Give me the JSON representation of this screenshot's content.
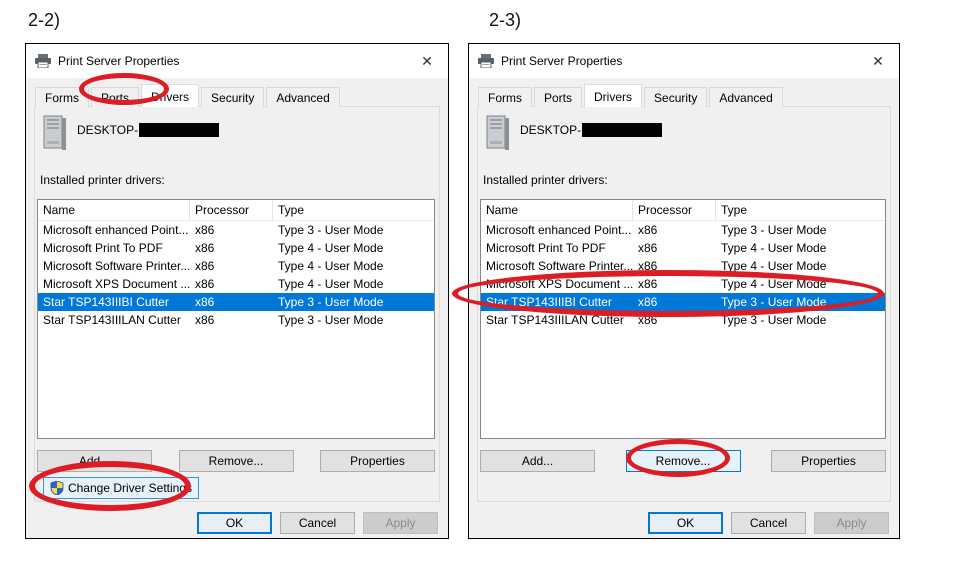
{
  "page": {
    "figure_labels": [
      "2-2)",
      "2-3)"
    ],
    "colors": {
      "annotation_red": "#dd1c24",
      "accent_blue": "#0078d7",
      "dialog_bg": "#f0f0f0",
      "selected_row_bg": "#0078d7"
    }
  },
  "windows": [
    {
      "title": "Print Server Properties",
      "close_glyph": "✕",
      "titlebar_icon": "printer-icon",
      "tabs": [
        "Forms",
        "Ports",
        "Drivers",
        "Security",
        "Advanced"
      ],
      "active_tab": "Drivers",
      "server_icon": "computer-icon",
      "server_name": "DESKTOP-",
      "server_name_redacted": true,
      "list_label": "Installed printer drivers:",
      "columns": [
        "Name",
        "Processor",
        "Type"
      ],
      "rows": [
        {
          "name": "Microsoft enhanced Point...",
          "processor": "x86",
          "type": "Type 3 - User Mode",
          "selected": false
        },
        {
          "name": "Microsoft Print To PDF",
          "processor": "x86",
          "type": "Type 4 - User Mode",
          "selected": false
        },
        {
          "name": "Microsoft Software Printer...",
          "processor": "x86",
          "type": "Type 4 - User Mode",
          "selected": false
        },
        {
          "name": "Microsoft XPS Document ...",
          "processor": "x86",
          "type": "Type 4 - User Mode",
          "selected": false
        },
        {
          "name": "Star TSP143IIIBI Cutter",
          "processor": "x86",
          "type": "Type 3 - User Mode",
          "selected": true
        },
        {
          "name": "Star TSP143IIILAN Cutter",
          "processor": "x86",
          "type": "Type 3 - User Mode",
          "selected": false
        }
      ],
      "buttons": {
        "add": "Add...",
        "remove": "Remove...",
        "properties": "Properties"
      },
      "change_driver_settings_label": "Change Driver Settings",
      "change_driver_settings_icon": "shield-icon",
      "footer_buttons": {
        "ok": "OK",
        "cancel": "Cancel",
        "apply": "Apply"
      },
      "annotated": [
        "Drivers tab circled",
        "Change Driver Settings circled"
      ]
    },
    {
      "title": "Print Server Properties",
      "close_glyph": "✕",
      "titlebar_icon": "printer-icon",
      "tabs": [
        "Forms",
        "Ports",
        "Drivers",
        "Security",
        "Advanced"
      ],
      "active_tab": "Drivers",
      "server_icon": "computer-icon",
      "server_name": "DESKTOP-",
      "server_name_redacted": true,
      "list_label": "Installed printer drivers:",
      "columns": [
        "Name",
        "Processor",
        "Type"
      ],
      "rows": [
        {
          "name": "Microsoft enhanced Point...",
          "processor": "x86",
          "type": "Type 3 - User Mode",
          "selected": false
        },
        {
          "name": "Microsoft Print To PDF",
          "processor": "x86",
          "type": "Type 4 - User Mode",
          "selected": false
        },
        {
          "name": "Microsoft Software Printer...",
          "processor": "x86",
          "type": "Type 4 - User Mode",
          "selected": false
        },
        {
          "name": "Microsoft XPS Document ...",
          "processor": "x86",
          "type": "Type 4 - User Mode",
          "selected": false
        },
        {
          "name": "Star TSP143IIIBI Cutter",
          "processor": "x86",
          "type": "Type 3 - User Mode",
          "selected": true
        },
        {
          "name": "Star TSP143IIILAN Cutter",
          "processor": "x86",
          "type": "Type 3 - User Mode",
          "selected": false
        }
      ],
      "buttons": {
        "add": "Add...",
        "remove": "Remove...",
        "properties": "Properties"
      },
      "footer_buttons": {
        "ok": "OK",
        "cancel": "Cancel",
        "apply": "Apply"
      },
      "annotated": [
        "Selected driver row circled",
        "Remove button circled"
      ]
    }
  ]
}
